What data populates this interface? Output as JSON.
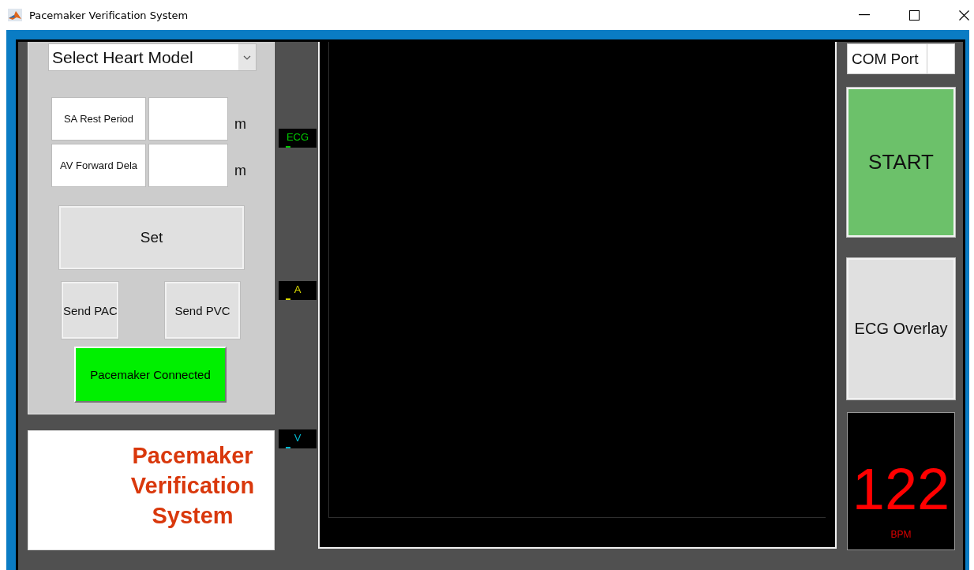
{
  "window": {
    "title": "Pacemaker Verification System"
  },
  "heart_model": {
    "value": "Select Heart Model"
  },
  "parameters": [
    {
      "label": "SA Rest Period",
      "unit": "m"
    },
    {
      "label": "AV Forward Dela",
      "unit": "m"
    }
  ],
  "set_button": {
    "label": "Set"
  },
  "send_buttons": [
    {
      "label": "Send PAC"
    },
    {
      "label": "Send PVC"
    }
  ],
  "connection": {
    "label": "Pacemaker Connected",
    "connected": true
  },
  "logo": {
    "text": "Pacemaker Verification System"
  },
  "channels": [
    {
      "label": "ECG",
      "color": "#00c800"
    },
    {
      "label": "A",
      "color": "#d8d800"
    },
    {
      "label": "V",
      "color": "#00b8d0"
    }
  ],
  "com_port": {
    "label": "COM Port"
  },
  "start_button": {
    "label": "START"
  },
  "overlay_button": {
    "label": "ECG Overlay"
  },
  "heart_rate": {
    "value": "122",
    "unit": "BPM"
  }
}
